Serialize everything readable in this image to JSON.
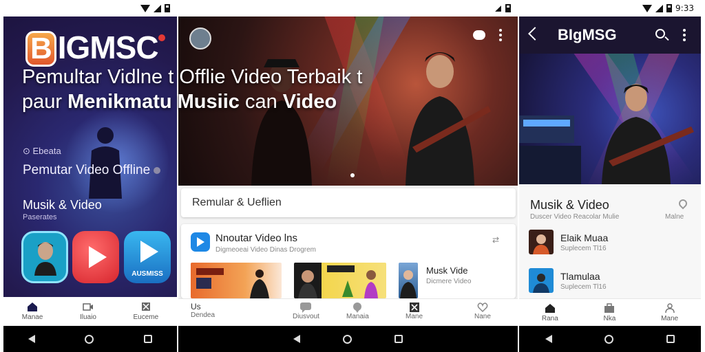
{
  "status": {
    "right_time": "9:33"
  },
  "left": {
    "logo_b": "B",
    "logo_rest": "IGMSC",
    "chip": "Ebeata",
    "subtitle1": "Pemutar Video Offline",
    "subtitle2": "Musik & Video",
    "subtitle3": "Paserates",
    "tile_label": "AUSMISS",
    "nav": [
      {
        "label": "Manae",
        "icon": "home-icon"
      },
      {
        "label": "Iluaio",
        "icon": "video-icon"
      },
      {
        "label": "Euceme",
        "icon": "music-icon"
      }
    ]
  },
  "headline": {
    "line1": "Pemultar Vidlne t Offlie Video Terbaik t",
    "line2_pre": "paur ",
    "line2_bold": "Menikmatu Musiic",
    "line2_mid": " can ",
    "line2_end": "Video"
  },
  "middle": {
    "card1_text": "Remular & Ueflien",
    "card2_title": "Nnoutar Video lns",
    "card2_sub": "Digmeoeai Video Dinas Drogrem",
    "thumb_title": "Musk Vide",
    "thumb_sub": "Dicmere Video",
    "nav": [
      {
        "label": "Us",
        "sub": "Dendea",
        "icon": "home-icon"
      },
      {
        "label": "Diusvout",
        "icon": "chat-icon"
      },
      {
        "label": "Manaia",
        "icon": "location-icon"
      },
      {
        "label": "Mane",
        "icon": "music-icon"
      },
      {
        "label": "Nane",
        "icon": "heart-icon"
      }
    ]
  },
  "right": {
    "title": "BIgMSG",
    "section_title": "Musik & Video",
    "section_sub": "Duscer Video Reacolar Mulie",
    "section_more": "Malne",
    "rows": [
      {
        "title": "Elaik Muaa",
        "sub": "Suplecem Tl16"
      },
      {
        "title": "Tlamulaa",
        "sub": "Suplecem Tl16"
      }
    ],
    "nav": [
      {
        "label": "Rana",
        "icon": "home-icon"
      },
      {
        "label": "Nka",
        "icon": "briefcase-icon"
      },
      {
        "label": "Mane",
        "icon": "profile-icon"
      }
    ]
  }
}
